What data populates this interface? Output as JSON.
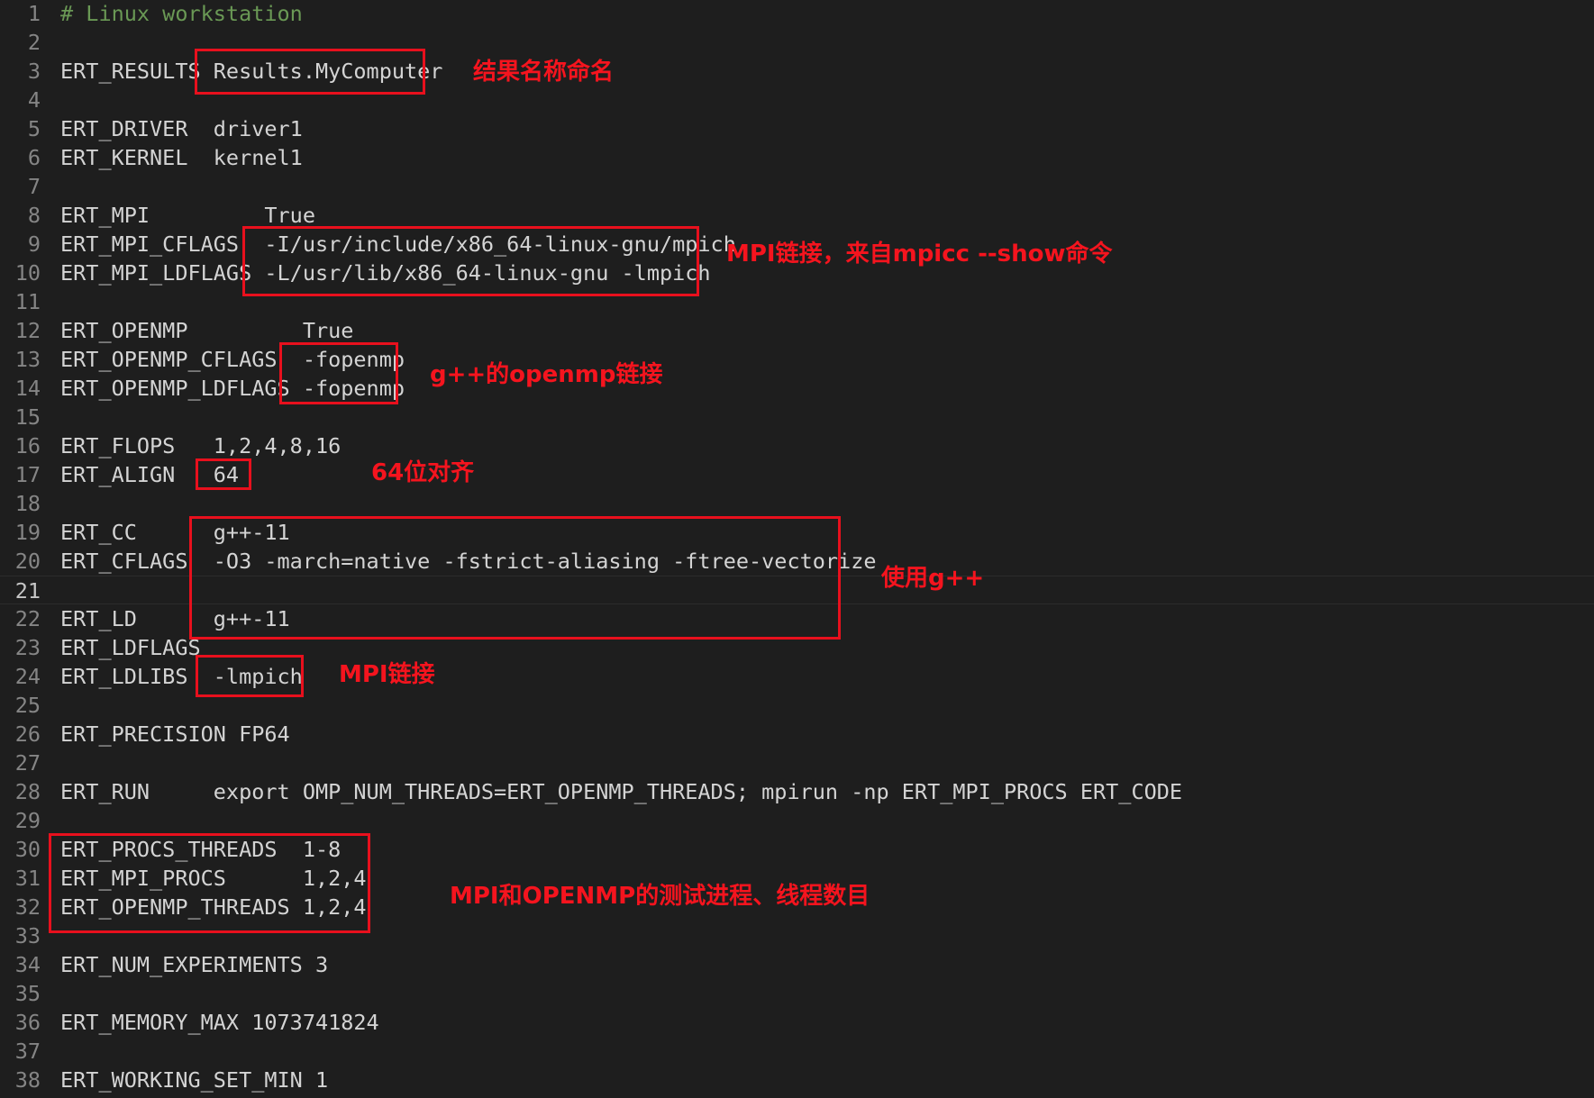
{
  "editor": {
    "lines": [
      {
        "n": "1",
        "text": "# Linux workstation",
        "type": "comment"
      },
      {
        "n": "2",
        "text": ""
      },
      {
        "n": "3",
        "text": "ERT_RESULTS Results.MyComputer"
      },
      {
        "n": "4",
        "text": ""
      },
      {
        "n": "5",
        "text": "ERT_DRIVER  driver1"
      },
      {
        "n": "6",
        "text": "ERT_KERNEL  kernel1"
      },
      {
        "n": "7",
        "text": ""
      },
      {
        "n": "8",
        "text": "ERT_MPI         True"
      },
      {
        "n": "9",
        "text": "ERT_MPI_CFLAGS  -I/usr/include/x86_64-linux-gnu/mpich"
      },
      {
        "n": "10",
        "text": "ERT_MPI_LDFLAGS -L/usr/lib/x86_64-linux-gnu -lmpich"
      },
      {
        "n": "11",
        "text": ""
      },
      {
        "n": "12",
        "text": "ERT_OPENMP         True"
      },
      {
        "n": "13",
        "text": "ERT_OPENMP_CFLAGS  -fopenmp"
      },
      {
        "n": "14",
        "text": "ERT_OPENMP_LDFLAGS -fopenmp"
      },
      {
        "n": "15",
        "text": ""
      },
      {
        "n": "16",
        "text": "ERT_FLOPS   1,2,4,8,16"
      },
      {
        "n": "17",
        "text": "ERT_ALIGN   64"
      },
      {
        "n": "18",
        "text": ""
      },
      {
        "n": "19",
        "text": "ERT_CC      g++-11"
      },
      {
        "n": "20",
        "text": "ERT_CFLAGS  -O3 -march=native -fstrict-aliasing -ftree-vectorize"
      },
      {
        "n": "21",
        "text": "",
        "current": true
      },
      {
        "n": "22",
        "text": "ERT_LD      g++-11"
      },
      {
        "n": "23",
        "text": "ERT_LDFLAGS"
      },
      {
        "n": "24",
        "text": "ERT_LDLIBS  -lmpich"
      },
      {
        "n": "25",
        "text": ""
      },
      {
        "n": "26",
        "text": "ERT_PRECISION FP64"
      },
      {
        "n": "27",
        "text": ""
      },
      {
        "n": "28",
        "text": "ERT_RUN     export OMP_NUM_THREADS=ERT_OPENMP_THREADS; mpirun -np ERT_MPI_PROCS ERT_CODE"
      },
      {
        "n": "29",
        "text": ""
      },
      {
        "n": "30",
        "text": "ERT_PROCS_THREADS  1-8"
      },
      {
        "n": "31",
        "text": "ERT_MPI_PROCS      1,2,4"
      },
      {
        "n": "32",
        "text": "ERT_OPENMP_THREADS 1,2,4"
      },
      {
        "n": "33",
        "text": ""
      },
      {
        "n": "34",
        "text": "ERT_NUM_EXPERIMENTS 3"
      },
      {
        "n": "35",
        "text": ""
      },
      {
        "n": "36",
        "text": "ERT_MEMORY_MAX 1073741824"
      },
      {
        "n": "37",
        "text": ""
      },
      {
        "n": "38",
        "text": "ERT_WORKING_SET_MIN 1"
      }
    ]
  },
  "annotations": {
    "results_name": "结果名称命名",
    "mpi_link_show": "MPI链接，来自mpicc --show命令",
    "gpp_openmp": "g++的openmp链接",
    "align64": "64位对齐",
    "use_gpp": "使用g++",
    "mpi_link": "MPI链接",
    "mpi_openmp_threads": "MPI和OPENMP的测试进程、线程数目"
  },
  "colors": {
    "background": "#1e1e1e",
    "text": "#d4d4d4",
    "comment": "#6a9955",
    "gutter": "#858585",
    "annotation_red": "#f5141e"
  }
}
